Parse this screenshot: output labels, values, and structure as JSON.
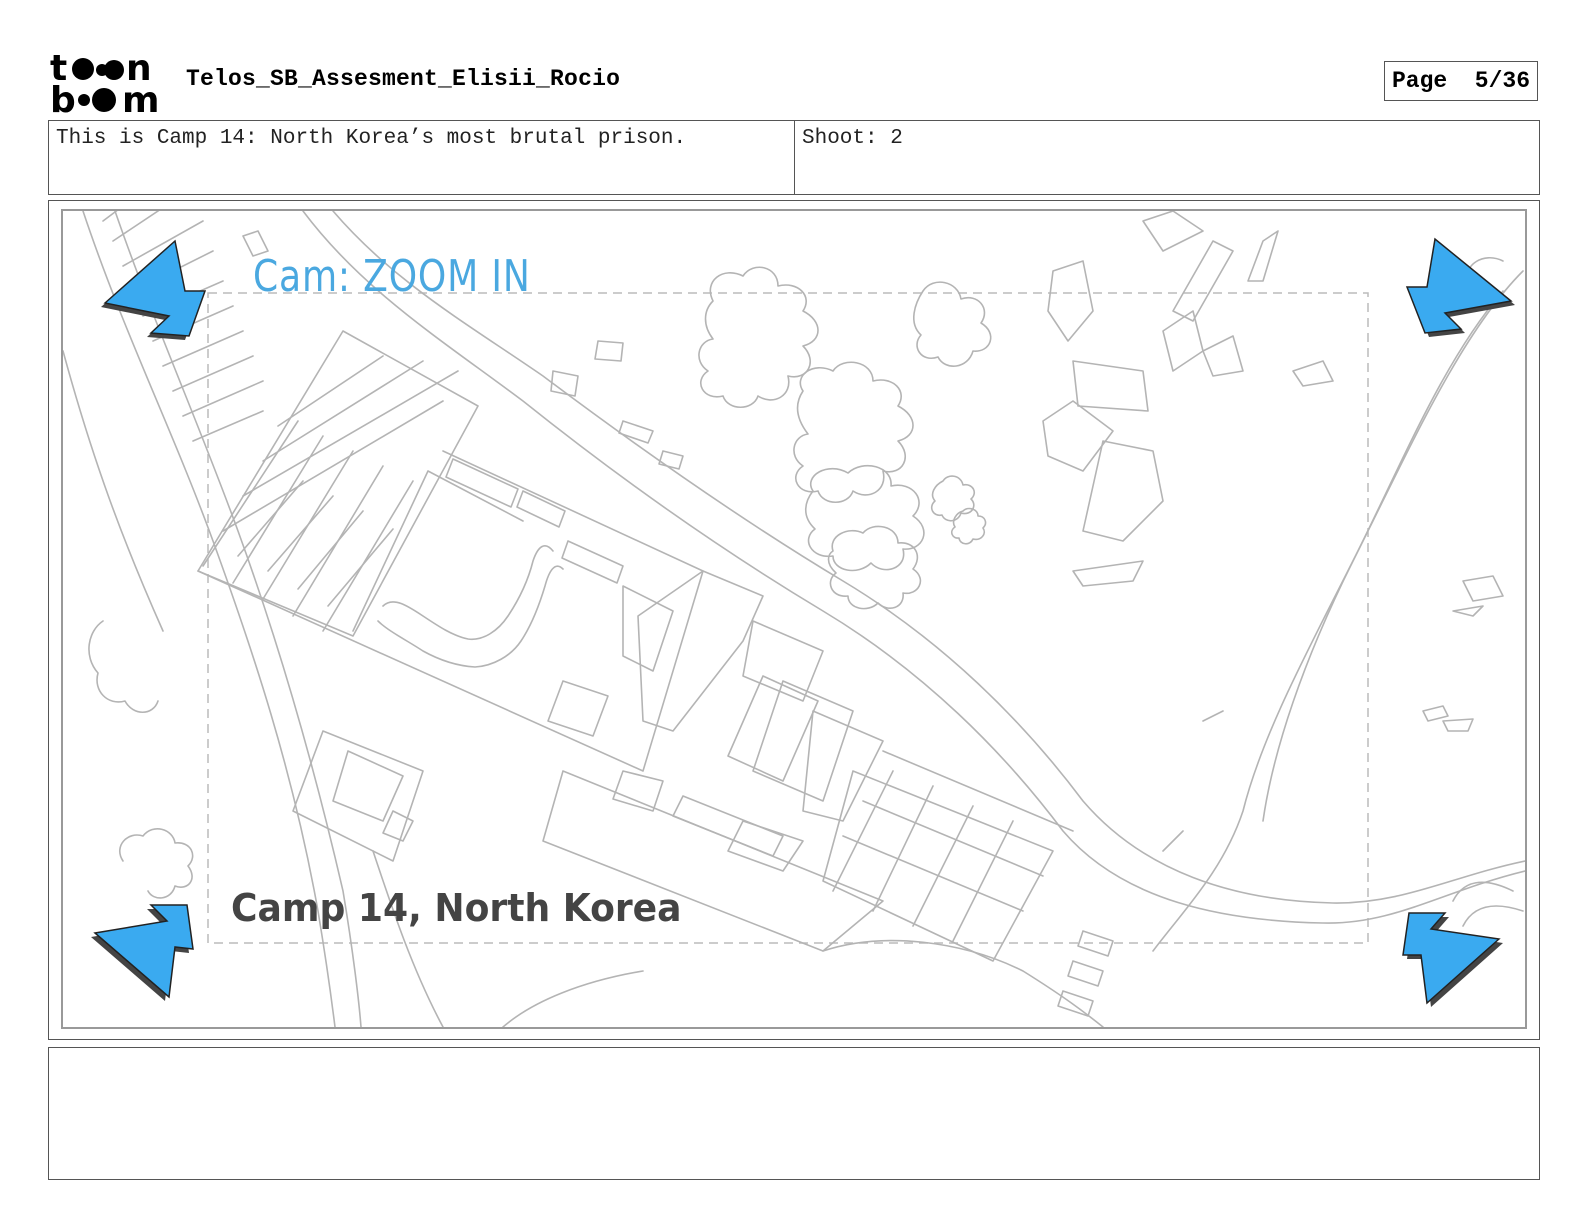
{
  "header": {
    "logo_icon": "toonboom-logo",
    "project_title": "Telos_SB_Assesment_Elisii_Rocio",
    "page_label": "Page",
    "page_number": "5/36"
  },
  "panel_info": {
    "dialogue": "This is Camp 14: North Korea’s most brutal prison.",
    "shoot": "Shoot: 2"
  },
  "panel": {
    "camera_note": "Cam: ZOOM IN",
    "location_caption": "Camp 14, North Korea",
    "camera_move": "zoom-in",
    "arrow_icons": [
      "arrow-top-left-icon",
      "arrow-top-right-icon",
      "arrow-bottom-left-icon",
      "arrow-bottom-right-icon"
    ],
    "colors": {
      "arrow": "#3aaaf0",
      "arrow_shadow": "#444444",
      "sketch": "#b4b4b4",
      "camera_note": "#4aa8e0",
      "caption": "#444444"
    }
  },
  "notes": {
    "text": ""
  }
}
